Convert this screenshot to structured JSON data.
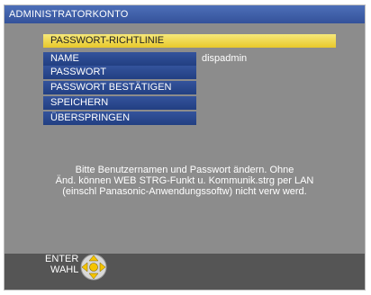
{
  "window": {
    "title": "ADMINISTRATORKONTO"
  },
  "menu": {
    "items": [
      {
        "label": "PASSWORT-RICHTLINIE",
        "highlighted": true
      },
      {
        "label": "NAME",
        "value": "dispadmin"
      },
      {
        "label": "PASSWORT"
      },
      {
        "label": "PASSWORT BESTÄTIGEN"
      },
      {
        "label": "SPEICHERN"
      },
      {
        "label": "ÜBERSPRINGEN"
      }
    ]
  },
  "info": {
    "text": "Bitte Benutzernamen und Passwort ändern.  Ohne\nÄnd. können WEB STRG-Funkt u.  Kommunik.strg per LAN\n(einschl Panasonic-Anwendungssoftw) nicht verw werd."
  },
  "footer": {
    "enter_label": "ENTER",
    "select_label": "WAHL",
    "icon": "dpad-icon"
  },
  "colors": {
    "background": "#8c8c8c",
    "titlebar": "#3b5ba6",
    "menu_item": "#2a4a8f",
    "highlight": "#f0d84e",
    "footer": "#555555",
    "dpad_accent": "#f5c400"
  }
}
